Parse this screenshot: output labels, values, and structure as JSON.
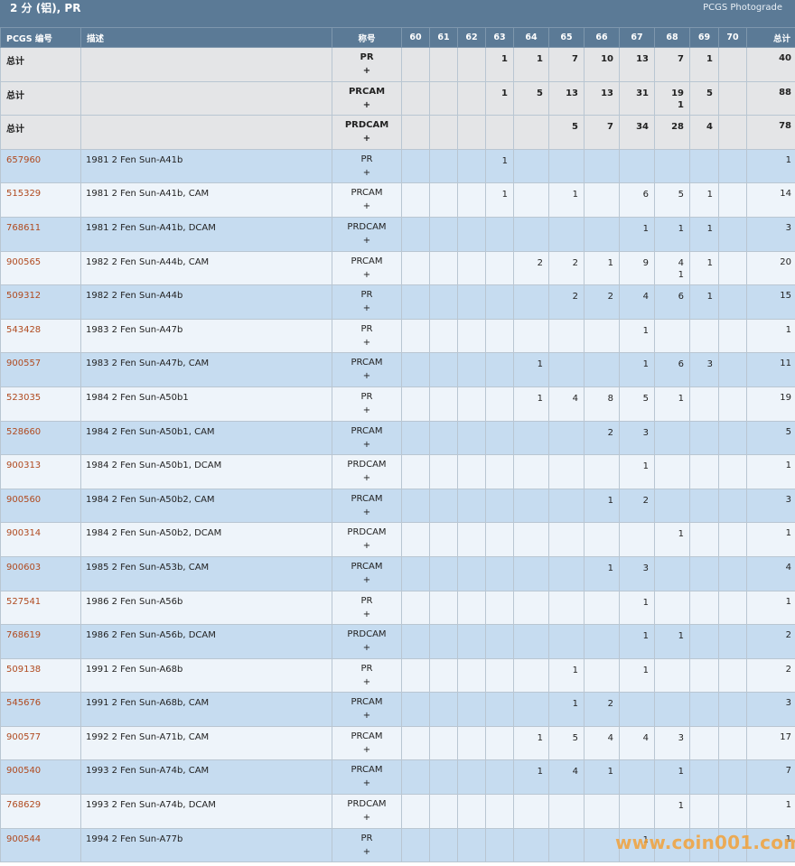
{
  "header": {
    "title": "2 分 (铝), PR",
    "brand": "PCGS Photograde"
  },
  "columns": {
    "id": "PCGS 编号",
    "desc": "描述",
    "name": "称号",
    "grades": [
      "60",
      "61",
      "62",
      "63",
      "64",
      "65",
      "66",
      "67",
      "68",
      "69",
      "70"
    ],
    "total": "总计"
  },
  "summary_rows": [
    {
      "label": "总计",
      "name": "PR",
      "plus": "+",
      "grades": [
        "",
        "",
        "",
        "1",
        "1",
        "7",
        "10",
        "13",
        "7",
        "1",
        ""
      ],
      "total": "40"
    },
    {
      "label": "总计",
      "name": "PRCAM",
      "plus": "+",
      "grades": [
        "",
        "",
        "",
        "1",
        "5",
        "13",
        "13",
        "31",
        "19\n1",
        "5",
        ""
      ],
      "total": "88"
    },
    {
      "label": "总计",
      "name": "PRDCAM",
      "plus": "+",
      "grades": [
        "",
        "",
        "",
        "",
        "",
        "5",
        "7",
        "34",
        "28",
        "4",
        ""
      ],
      "total": "78"
    }
  ],
  "rows": [
    {
      "id": "657960",
      "desc": "1981 2 Fen Sun-A41b",
      "name": "PR",
      "plus": "+",
      "grades": [
        "",
        "",
        "",
        "1",
        "",
        "",
        "",
        "",
        "",
        "",
        ""
      ],
      "total": "1"
    },
    {
      "id": "515329",
      "desc": "1981 2 Fen Sun-A41b, CAM",
      "name": "PRCAM",
      "plus": "+",
      "grades": [
        "",
        "",
        "",
        "1",
        "",
        "1",
        "",
        "6",
        "5",
        "1",
        ""
      ],
      "total": "14"
    },
    {
      "id": "768611",
      "desc": "1981 2 Fen Sun-A41b, DCAM",
      "name": "PRDCAM",
      "plus": "+",
      "grades": [
        "",
        "",
        "",
        "",
        "",
        "",
        "",
        "1",
        "1",
        "1",
        ""
      ],
      "total": "3"
    },
    {
      "id": "900565",
      "desc": "1982 2 Fen Sun-A44b, CAM",
      "name": "PRCAM",
      "plus": "+",
      "grades": [
        "",
        "",
        "",
        "",
        "2",
        "2",
        "1",
        "9",
        "4\n1",
        "1",
        ""
      ],
      "total": "20"
    },
    {
      "id": "509312",
      "desc": "1982 2 Fen Sun-A44b",
      "name": "PR",
      "plus": "+",
      "grades": [
        "",
        "",
        "",
        "",
        "",
        "2",
        "2",
        "4",
        "6",
        "1",
        ""
      ],
      "total": "15"
    },
    {
      "id": "543428",
      "desc": "1983 2 Fen Sun-A47b",
      "name": "PR",
      "plus": "+",
      "grades": [
        "",
        "",
        "",
        "",
        "",
        "",
        "",
        "1",
        "",
        "",
        ""
      ],
      "total": "1"
    },
    {
      "id": "900557",
      "desc": "1983 2 Fen Sun-A47b, CAM",
      "name": "PRCAM",
      "plus": "+",
      "grades": [
        "",
        "",
        "",
        "",
        "1",
        "",
        "",
        "1",
        "6",
        "3",
        ""
      ],
      "total": "11"
    },
    {
      "id": "523035",
      "desc": "1984 2 Fen Sun-A50b1",
      "name": "PR",
      "plus": "+",
      "grades": [
        "",
        "",
        "",
        "",
        "1",
        "4",
        "8",
        "5",
        "1",
        "",
        ""
      ],
      "total": "19"
    },
    {
      "id": "528660",
      "desc": "1984 2 Fen Sun-A50b1, CAM",
      "name": "PRCAM",
      "plus": "+",
      "grades": [
        "",
        "",
        "",
        "",
        "",
        "",
        "2",
        "3",
        "",
        "",
        ""
      ],
      "total": "5"
    },
    {
      "id": "900313",
      "desc": "1984 2 Fen Sun-A50b1, DCAM",
      "name": "PRDCAM",
      "plus": "+",
      "grades": [
        "",
        "",
        "",
        "",
        "",
        "",
        "",
        "1",
        "",
        "",
        ""
      ],
      "total": "1"
    },
    {
      "id": "900560",
      "desc": "1984 2 Fen Sun-A50b2, CAM",
      "name": "PRCAM",
      "plus": "+",
      "grades": [
        "",
        "",
        "",
        "",
        "",
        "",
        "1",
        "2",
        "",
        "",
        ""
      ],
      "total": "3"
    },
    {
      "id": "900314",
      "desc": "1984 2 Fen Sun-A50b2, DCAM",
      "name": "PRDCAM",
      "plus": "+",
      "grades": [
        "",
        "",
        "",
        "",
        "",
        "",
        "",
        "",
        "1",
        "",
        ""
      ],
      "total": "1"
    },
    {
      "id": "900603",
      "desc": "1985 2 Fen Sun-A53b, CAM",
      "name": "PRCAM",
      "plus": "+",
      "grades": [
        "",
        "",
        "",
        "",
        "",
        "",
        "1",
        "3",
        "",
        "",
        ""
      ],
      "total": "4"
    },
    {
      "id": "527541",
      "desc": "1986 2 Fen Sun-A56b",
      "name": "PR",
      "plus": "+",
      "grades": [
        "",
        "",
        "",
        "",
        "",
        "",
        "",
        "1",
        "",
        "",
        ""
      ],
      "total": "1"
    },
    {
      "id": "768619",
      "desc": "1986 2 Fen Sun-A56b, DCAM",
      "name": "PRDCAM",
      "plus": "+",
      "grades": [
        "",
        "",
        "",
        "",
        "",
        "",
        "",
        "1",
        "1",
        "",
        ""
      ],
      "total": "2"
    },
    {
      "id": "509138",
      "desc": "1991 2 Fen Sun-A68b",
      "name": "PR",
      "plus": "+",
      "grades": [
        "",
        "",
        "",
        "",
        "",
        "1",
        "",
        "1",
        "",
        "",
        ""
      ],
      "total": "2"
    },
    {
      "id": "545676",
      "desc": "1991 2 Fen Sun-A68b, CAM",
      "name": "PRCAM",
      "plus": "+",
      "grades": [
        "",
        "",
        "",
        "",
        "",
        "1",
        "2",
        "",
        "",
        "",
        ""
      ],
      "total": "3"
    },
    {
      "id": "900577",
      "desc": "1992 2 Fen Sun-A71b, CAM",
      "name": "PRCAM",
      "plus": "+",
      "grades": [
        "",
        "",
        "",
        "",
        "1",
        "5",
        "4",
        "4",
        "3",
        "",
        ""
      ],
      "total": "17"
    },
    {
      "id": "900540",
      "desc": "1993 2 Fen Sun-A74b, CAM",
      "name": "PRCAM",
      "plus": "+",
      "grades": [
        "",
        "",
        "",
        "",
        "1",
        "4",
        "1",
        "",
        "1",
        "",
        ""
      ],
      "total": "7"
    },
    {
      "id": "768629",
      "desc": "1993 2 Fen Sun-A74b, DCAM",
      "name": "PRDCAM",
      "plus": "+",
      "grades": [
        "",
        "",
        "",
        "",
        "",
        "",
        "",
        "",
        "1",
        "",
        ""
      ],
      "total": "1"
    },
    {
      "id": "900544",
      "desc": "1994 2 Fen Sun-A77b",
      "name": "PR",
      "plus": "+",
      "grades": [
        "",
        "",
        "",
        "",
        "",
        "",
        "",
        "1",
        "",
        "",
        ""
      ],
      "total": "1"
    }
  ],
  "watermark": "www.coin001.com"
}
